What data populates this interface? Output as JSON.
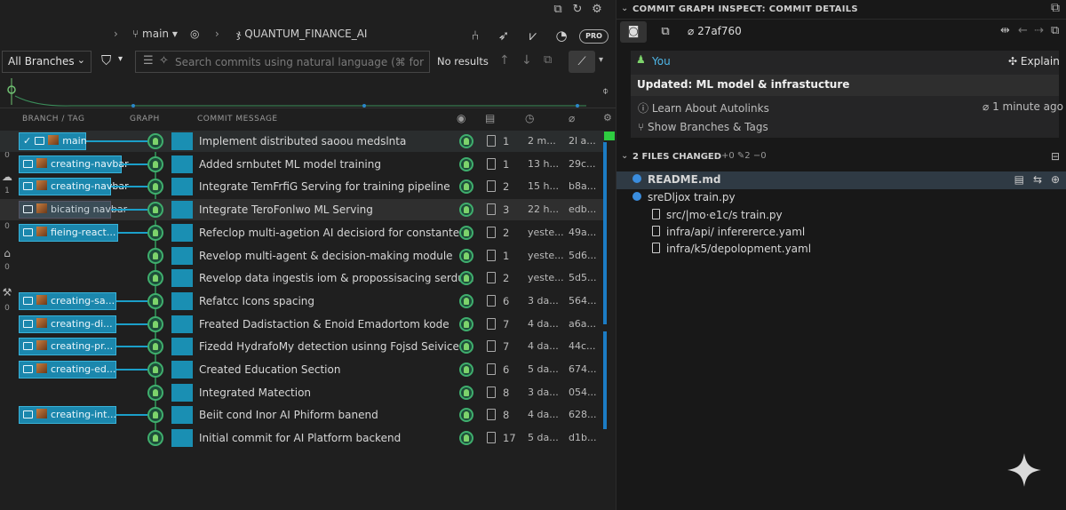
{
  "repo": {
    "branch": "main",
    "name": "QUANTUM_FINANCE_AI",
    "pro_badge": "PRO"
  },
  "filter": {
    "branches_label": "All Branches",
    "search_placeholder": "Search commits using natural language (⌘ for histor",
    "no_results": "No results"
  },
  "columns": {
    "branch_tag": "BRANCH / TAG",
    "graph": "GRAPH",
    "commit_message": "COMMIT MESSAGE"
  },
  "sidebar_counts": [
    "0",
    "1",
    "0",
    "0",
    "0"
  ],
  "commits": [
    {
      "branch": "main",
      "message": "Implement distributed saoou medslnta",
      "files": "1",
      "date": "2 m...",
      "sha": "2l a..."
    },
    {
      "branch": "creating-navbar",
      "message": "Added srnbutet ML model training",
      "files": "1",
      "date": "13 h...",
      "sha": "29c..."
    },
    {
      "branch": "creating-navbar",
      "message": "Integrate TemFrfiG Serving for training pipeline",
      "files": "2",
      "date": "15 h...",
      "sha": "b8a..."
    },
    {
      "branch": "bicating navbar",
      "message": "Integrate TeroFonlwo ML Serving",
      "files": "3",
      "date": "22 h...",
      "sha": "edb..."
    },
    {
      "branch": "fieing-react...",
      "message": "Refeclop multi-agetion AI decisiord for constante",
      "files": "2",
      "date": "yeste...",
      "sha": "49a..."
    },
    {
      "branch": "",
      "message": "Revelop multi-agent & decision-making module",
      "files": "1",
      "date": "yeste...",
      "sha": "5d6..."
    },
    {
      "branch": "",
      "message": "Revelop data ingestis iom & propossisacing serdule",
      "files": "2",
      "date": "yeste...",
      "sha": "5d5..."
    },
    {
      "branch": "creating-sa...",
      "message": "Refatcc Icons spacing",
      "files": "6",
      "date": "3 da...",
      "sha": "564..."
    },
    {
      "branch": "creating-di...",
      "message": "Freated Dadistaction & Enoid Emadortom kode",
      "files": "7",
      "date": "4 da...",
      "sha": "a6a..."
    },
    {
      "branch": "creating-pr...",
      "message": "Fizedd HydrafoMy detection usinng Fojsd Seivice",
      "files": "7",
      "date": "4 da...",
      "sha": "44c..."
    },
    {
      "branch": "creating-ed...",
      "message": "Created Education Section",
      "files": "6",
      "date": "5 da...",
      "sha": "674..."
    },
    {
      "branch": "",
      "message": "Integrated Matection",
      "files": "8",
      "date": "3 da...",
      "sha": "054..."
    },
    {
      "branch": "creating-int...",
      "message": "Beiit cond Inor AI Phiform banend",
      "files": "8",
      "date": "4 da...",
      "sha": "628..."
    },
    {
      "branch": "",
      "message": "Initial commit for AI Platform backend",
      "files": "17",
      "date": "5 da...",
      "sha": "d1b..."
    }
  ],
  "details": {
    "header": "COMMIT GRAPH INSPECT: COMMIT DETAILS",
    "sha": "27af760",
    "author": "You",
    "explain": "Explain",
    "title": "Updated: ML model & infrastucture",
    "learn": "Learn About Autolinks",
    "ago": "1 minute ago",
    "show_branches": "Show Branches & Tags",
    "files_changed_label": "2 FILES CHANGED",
    "stats": "+0 ✎2 −0",
    "files": [
      {
        "name": "README.md"
      },
      {
        "name": "sreDljox  train.py"
      },
      {
        "name": "src/|mo·e1c/s  train.py"
      },
      {
        "name": "infra/api/  inferererce.yaml"
      },
      {
        "name": "infra/k5/depolopment.yaml"
      }
    ]
  },
  "colors": {
    "accent": "#1b87ad",
    "node": "#3fae6d",
    "link": "#4fb7e8"
  }
}
